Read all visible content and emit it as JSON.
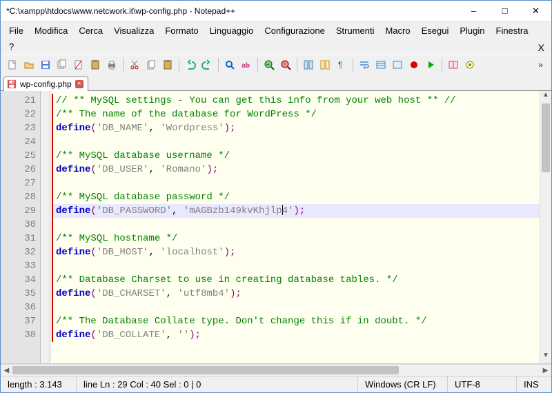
{
  "window": {
    "title": "*C:\\xampp\\htdocs\\www.netcwork.it\\wp-config.php - Notepad++"
  },
  "menu": {
    "items": [
      "File",
      "Modifica",
      "Cerca",
      "Visualizza",
      "Formato",
      "Linguaggio",
      "Configurazione",
      "Strumenti",
      "Macro",
      "Esegui",
      "Plugin",
      "Finestra",
      "?"
    ]
  },
  "tab": {
    "filename": "wp-config.php"
  },
  "code": {
    "first_line_no": 21,
    "highlight_line": 29,
    "lines": [
      [
        {
          "t": "// ** MySQL settings - You can get this info from your web host ** //",
          "c": "c-comment"
        }
      ],
      [
        {
          "t": "/** The name of the database for WordPress */",
          "c": "c-comment"
        }
      ],
      [
        {
          "t": "define",
          "c": "c-kw"
        },
        {
          "t": "(",
          "c": "c-punct"
        },
        {
          "t": "'DB_NAME'",
          "c": "c-str"
        },
        {
          "t": ", ",
          "c": "c-op"
        },
        {
          "t": "'Wordpress'",
          "c": "c-str"
        },
        {
          "t": ");",
          "c": "c-punct"
        }
      ],
      [],
      [
        {
          "t": "/** MySQL database username */",
          "c": "c-comment"
        }
      ],
      [
        {
          "t": "define",
          "c": "c-kw"
        },
        {
          "t": "(",
          "c": "c-punct"
        },
        {
          "t": "'DB_USER'",
          "c": "c-str"
        },
        {
          "t": ", ",
          "c": "c-op"
        },
        {
          "t": "'Romano'",
          "c": "c-str"
        },
        {
          "t": ");",
          "c": "c-punct"
        }
      ],
      [],
      [
        {
          "t": "/** MySQL database password */",
          "c": "c-comment"
        }
      ],
      [
        {
          "t": "define",
          "c": "c-kw"
        },
        {
          "t": "(",
          "c": "c-punct"
        },
        {
          "t": "'DB_PASSWORD'",
          "c": "c-str"
        },
        {
          "t": ", ",
          "c": "c-op"
        },
        {
          "t": "'mAGBzb149kvKhjlp",
          "c": "c-str"
        },
        {
          "t": "",
          "caret": true
        },
        {
          "t": "4'",
          "c": "c-str"
        },
        {
          "t": ");",
          "c": "c-punct"
        }
      ],
      [],
      [
        {
          "t": "/** MySQL hostname */",
          "c": "c-comment"
        }
      ],
      [
        {
          "t": "define",
          "c": "c-kw"
        },
        {
          "t": "(",
          "c": "c-punct"
        },
        {
          "t": "'DB_HOST'",
          "c": "c-str"
        },
        {
          "t": ", ",
          "c": "c-op"
        },
        {
          "t": "'localhost'",
          "c": "c-str"
        },
        {
          "t": ");",
          "c": "c-punct"
        }
      ],
      [],
      [
        {
          "t": "/** Database Charset to use in creating database tables. */",
          "c": "c-comment"
        }
      ],
      [
        {
          "t": "define",
          "c": "c-kw"
        },
        {
          "t": "(",
          "c": "c-punct"
        },
        {
          "t": "'DB_CHARSET'",
          "c": "c-str"
        },
        {
          "t": ", ",
          "c": "c-op"
        },
        {
          "t": "'utf8mb4'",
          "c": "c-str"
        },
        {
          "t": ");",
          "c": "c-punct"
        }
      ],
      [],
      [
        {
          "t": "/** The Database Collate type. Don't change this if in doubt. */",
          "c": "c-comment"
        }
      ],
      [
        {
          "t": "define",
          "c": "c-kw"
        },
        {
          "t": "(",
          "c": "c-punct"
        },
        {
          "t": "'DB_COLLATE'",
          "c": "c-str"
        },
        {
          "t": ", ",
          "c": "c-op"
        },
        {
          "t": "''",
          "c": "c-str"
        },
        {
          "t": ");",
          "c": "c-punct"
        }
      ]
    ]
  },
  "status": {
    "length": "length : 3.143",
    "pos": "line Ln : 29    Col : 40    Sel : 0 | 0",
    "eol": "Windows (CR LF)",
    "enc": "UTF-8",
    "ins": "INS"
  },
  "toolbar_icons": [
    "new-file",
    "open-file",
    "save",
    "copy-file",
    "cut-file",
    "paste-file",
    "print",
    "sep",
    "cut",
    "copy",
    "paste",
    "sep",
    "undo",
    "redo",
    "sep",
    "find",
    "replace",
    "sep",
    "zoom-in",
    "zoom-out",
    "sep",
    "sync",
    "all-chars",
    "indent-guide",
    "sep",
    "wrap",
    "hidden",
    "monitor",
    "record",
    "play",
    "sep",
    "compare",
    "plugins"
  ]
}
